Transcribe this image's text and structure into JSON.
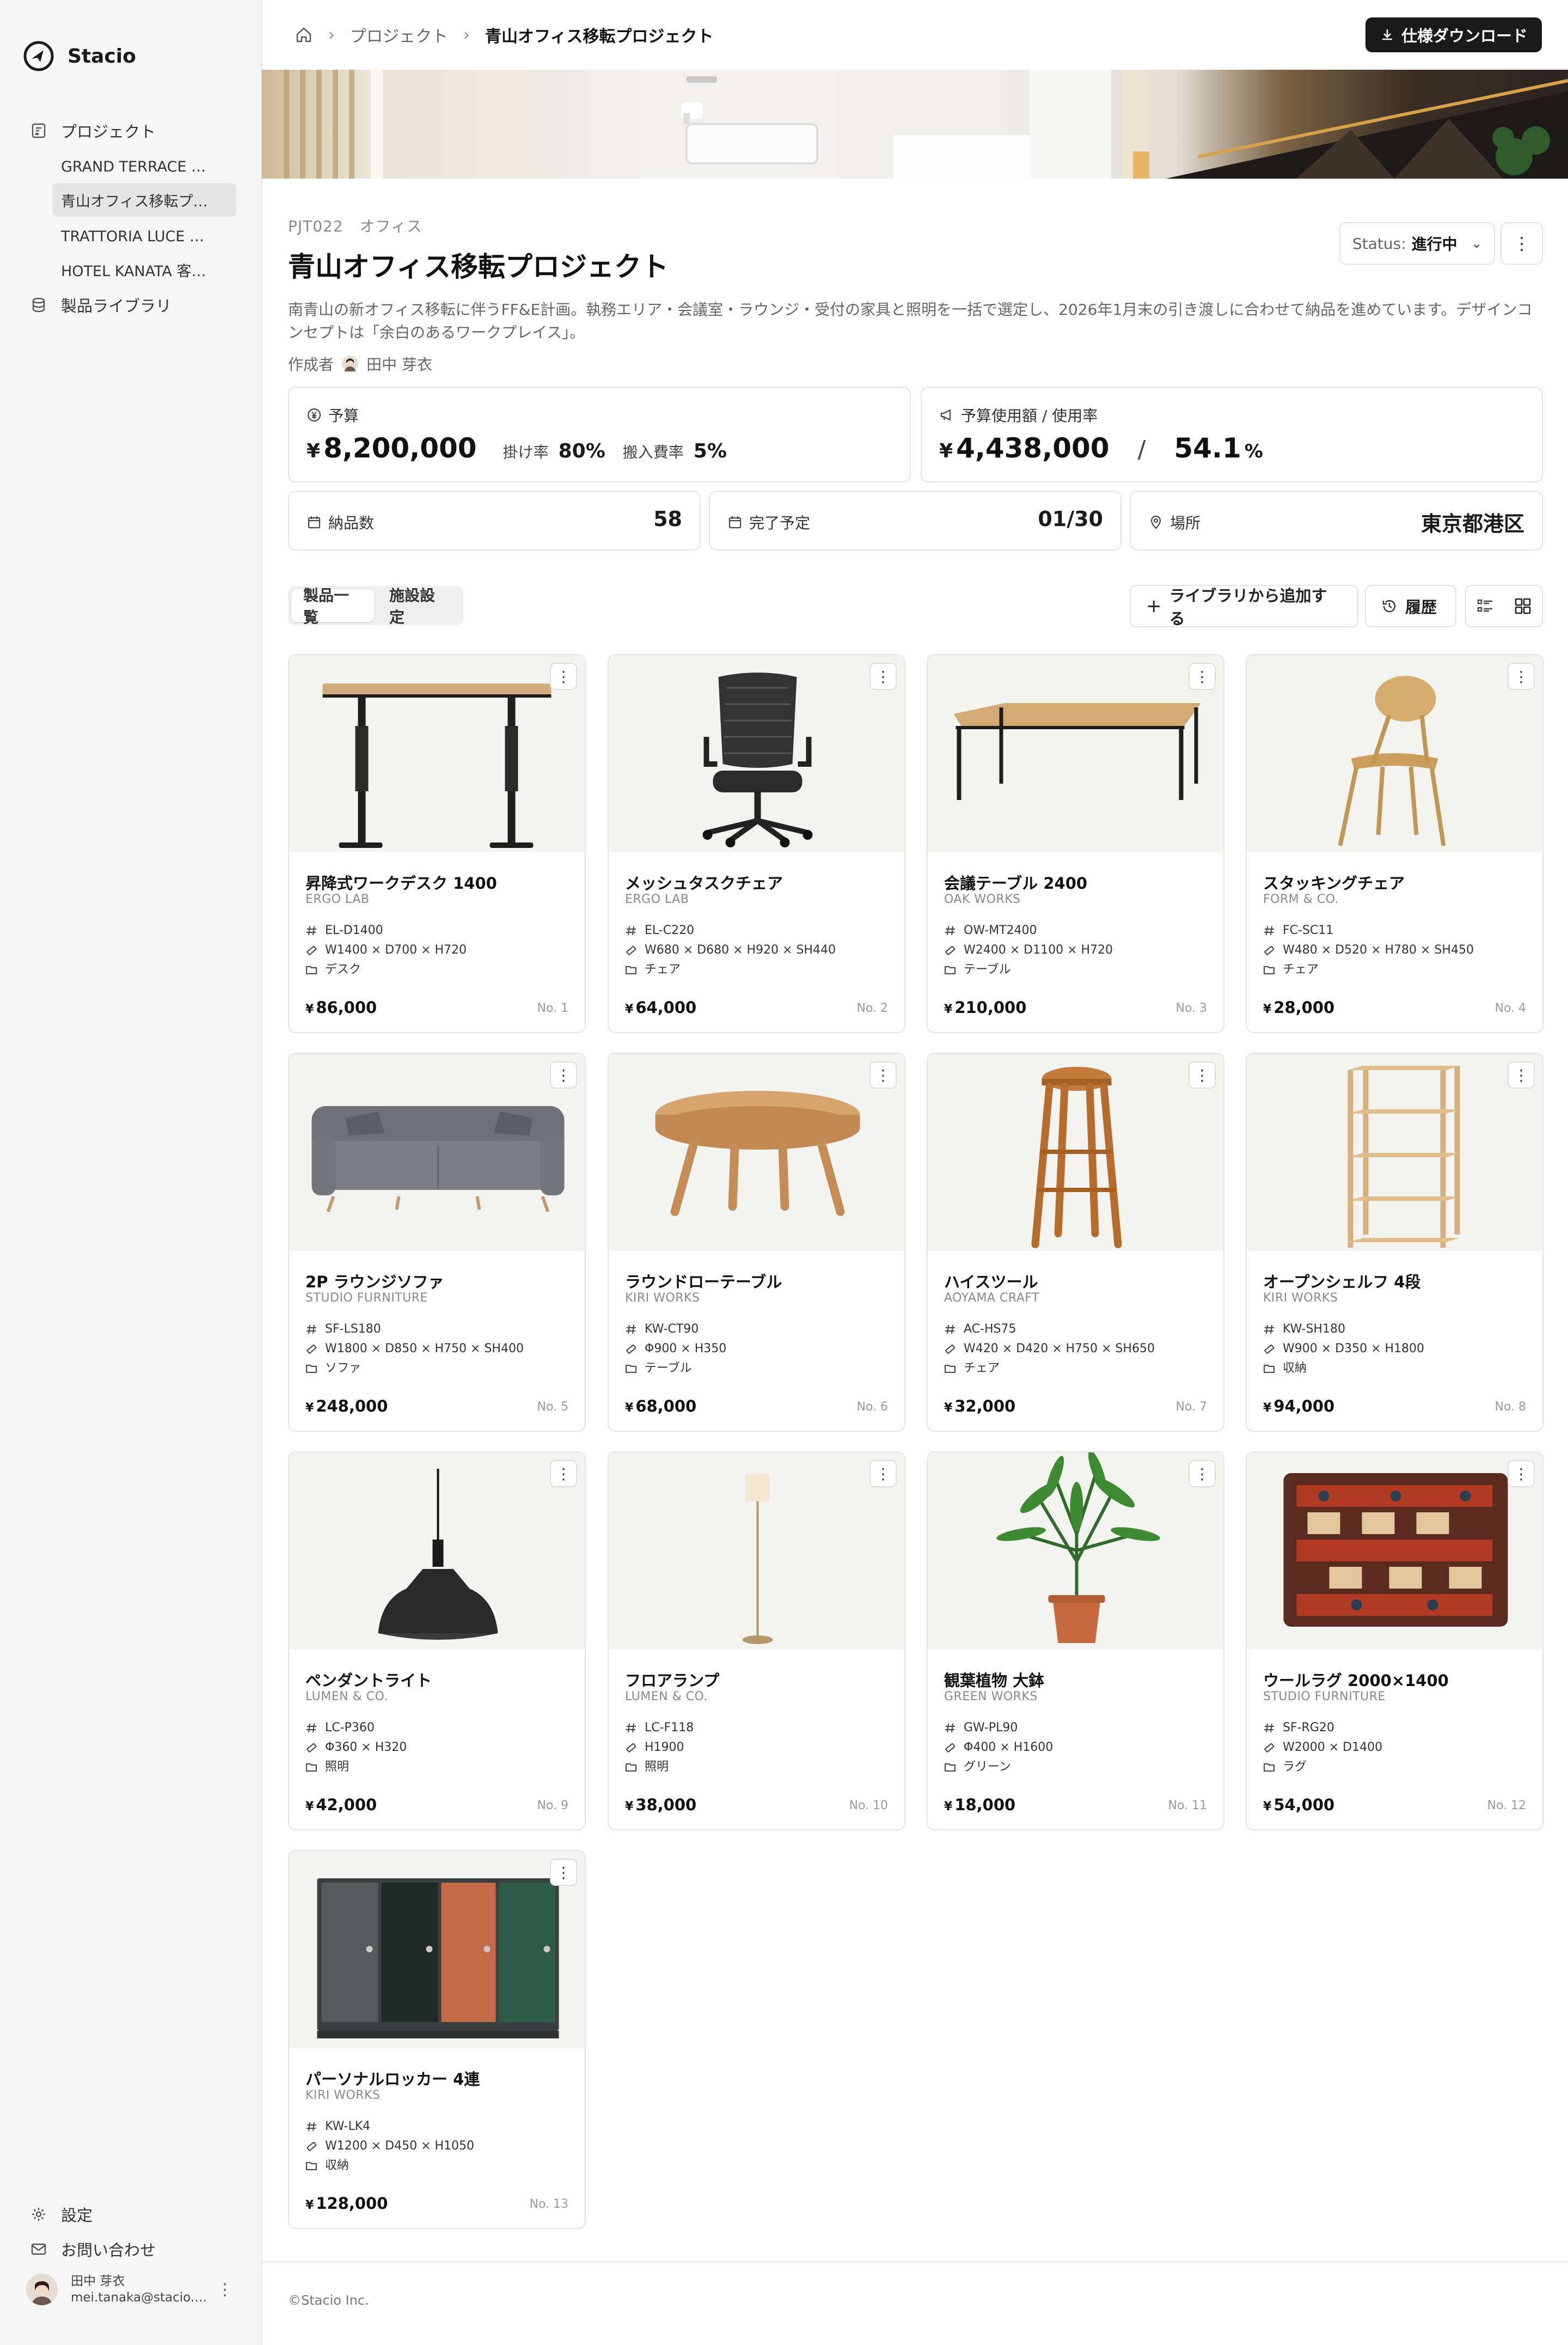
{
  "brand": {
    "name": "Stacio"
  },
  "sidebar": {
    "projects_label": "プロジェクト",
    "project_items": [
      {
        "label": "GRAND TERRACE 京…",
        "active": false
      },
      {
        "label": "青山オフィス移転プ…",
        "active": true
      },
      {
        "label": "TRATTORIA LUCE 表…",
        "active": false
      },
      {
        "label": "HOTEL KANATA 客室…",
        "active": false
      }
    ],
    "library_label": "製品ライブラリ",
    "settings_label": "設定",
    "contact_label": "お問い合わせ",
    "user": {
      "name": "田中 芽衣",
      "email": "mei.tanaka@stacio.c…"
    }
  },
  "header": {
    "breadcrumb": [
      "プロジェクト",
      "青山オフィス移転プロジェクト"
    ],
    "download_label": "仕様ダウンロード"
  },
  "project": {
    "code": "PJT022",
    "category": "オフィス",
    "title": "青山オフィス移転プロジェクト",
    "description": "南青山の新オフィス移転に伴うFF&E計画。執務エリア・会議室・ラウンジ・受付の家具と照明を一括で選定し、2026年1月末の引き渡しに合わせて納品を進めています。デザインコンセプトは「余白のあるワークプレイス」。",
    "author_label": "作成者",
    "author": "田中 芽衣",
    "status_label": "Status:",
    "status_value": "進行中"
  },
  "stats": {
    "budget_label": "予算",
    "budget_yen": "¥",
    "budget": "8,200,000",
    "rate_label": "掛け率",
    "rate": "80%",
    "delivery_label": "搬入費率",
    "delivery": "5%",
    "usage_label": "予算使用額 / 使用率",
    "usage_yen": "¥",
    "usage": "4,438,000",
    "usage_sep": "/",
    "usage_pct": "54.1",
    "usage_pct_unit": "%",
    "items_label": "納品数",
    "items": "58",
    "due_label": "完了予定",
    "due": "01/30",
    "location_label": "場所",
    "location": "東京都港区"
  },
  "tabs": [
    "製品一覧",
    "施設設定"
  ],
  "toolbar": {
    "add_label": "ライブラリから追加する",
    "history_label": "履歴"
  },
  "products": [
    {
      "name": "昇降式ワークデスク 1400",
      "brand": "ERGO LAB",
      "code": "EL-D1400",
      "size": "W1400 × D700 × H720",
      "category": "デスク",
      "price": "86,000",
      "no": "No. 1"
    },
    {
      "name": "メッシュタスクチェア",
      "brand": "ERGO LAB",
      "code": "EL-C220",
      "size": "W680 × D680 × H920 × SH440",
      "category": "チェア",
      "price": "64,000",
      "no": "No. 2"
    },
    {
      "name": "会議テーブル 2400",
      "brand": "OAK WORKS",
      "code": "OW-MT2400",
      "size": "W2400 × D1100 × H720",
      "category": "テーブル",
      "price": "210,000",
      "no": "No. 3"
    },
    {
      "name": "スタッキングチェア",
      "brand": "FORM & CO.",
      "code": "FC-SC11",
      "size": "W480 × D520 × H780 × SH450",
      "category": "チェア",
      "price": "28,000",
      "no": "No. 4"
    },
    {
      "name": "2P ラウンジソファ",
      "brand": "STUDIO FURNITURE",
      "code": "SF-LS180",
      "size": "W1800 × D850 × H750 × SH400",
      "category": "ソファ",
      "price": "248,000",
      "no": "No. 5"
    },
    {
      "name": "ラウンドローテーブル",
      "brand": "KIRI WORKS",
      "code": "KW-CT90",
      "size": "Φ900 × H350",
      "category": "テーブル",
      "price": "68,000",
      "no": "No. 6"
    },
    {
      "name": "ハイスツール",
      "brand": "AOYAMA CRAFT",
      "code": "AC-HS75",
      "size": "W420 × D420 × H750 × SH650",
      "category": "チェア",
      "price": "32,000",
      "no": "No. 7"
    },
    {
      "name": "オープンシェルフ 4段",
      "brand": "KIRI WORKS",
      "code": "KW-SH180",
      "size": "W900 × D350 × H1800",
      "category": "収納",
      "price": "94,000",
      "no": "No. 8"
    },
    {
      "name": "ペンダントライト",
      "brand": "LUMEN & CO.",
      "code": "LC-P360",
      "size": "Φ360 × H320",
      "category": "照明",
      "price": "42,000",
      "no": "No. 9"
    },
    {
      "name": "フロアランプ",
      "brand": "LUMEN & CO.",
      "code": "LC-F118",
      "size": "H1900",
      "category": "照明",
      "price": "38,000",
      "no": "No. 10"
    },
    {
      "name": "観葉植物 大鉢",
      "brand": "GREEN WORKS",
      "code": "GW-PL90",
      "size": "Φ400 × H1600",
      "category": "グリーン",
      "price": "18,000",
      "no": "No. 11"
    },
    {
      "name": "ウールラグ 2000×1400",
      "brand": "STUDIO FURNITURE",
      "code": "SF-RG20",
      "size": "W2000 × D1400",
      "category": "ラグ",
      "price": "54,000",
      "no": "No. 12"
    },
    {
      "name": "パーソナルロッカー 4連",
      "brand": "KIRI WORKS",
      "code": "KW-LK4",
      "size": "W1200 × D450 × H1050",
      "category": "収納",
      "price": "128,000",
      "no": "No. 13"
    }
  ],
  "currency": "¥",
  "footer": {
    "copyright": "©Stacio Inc."
  },
  "colors": {
    "accent": "#1a1a1a",
    "sidebar_bg": "#f6f6f6",
    "card_border": "#e4e4e4"
  }
}
